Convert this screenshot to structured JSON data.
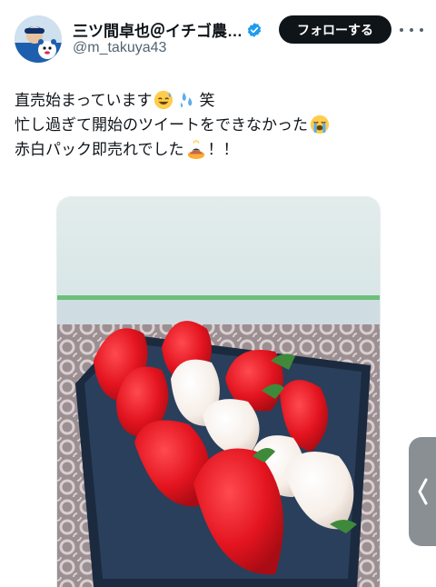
{
  "author": {
    "display_name": "三ツ間卓也＠イチゴ農…",
    "handle": "@m_takuya43",
    "avatar_icon": "avatar-baseball-player",
    "verified_icon": "verified-badge-icon",
    "verified_color": "#1d9bf0"
  },
  "actions": {
    "follow_label": "フォローする",
    "more_icon": "more-dots-icon"
  },
  "tweet": {
    "line1": {
      "text": "直売始まっています",
      "emoji1": "sweat-smile-emoji",
      "emoji2": "sweat-drops-emoji",
      "suffix": "笑"
    },
    "line2": {
      "text": "忙し過ぎて開始のツイートをできなかった",
      "emoji": "loudly-crying-emoji"
    },
    "line3": {
      "text": "赤白パック即売れでした",
      "emoji": "bowing-person-emoji",
      "suffix": "！！"
    }
  },
  "media": {
    "image_icon": "strawberry-pack-photo",
    "description_icon": "red-and-white-strawberries"
  },
  "side_panel": {
    "icon": "chevron-left-icon"
  },
  "colors": {
    "text_primary": "#0f1419",
    "text_secondary": "#536471",
    "button_bg": "#0f1419",
    "button_text": "#ffffff",
    "tab_bg": "#8a8f93"
  }
}
